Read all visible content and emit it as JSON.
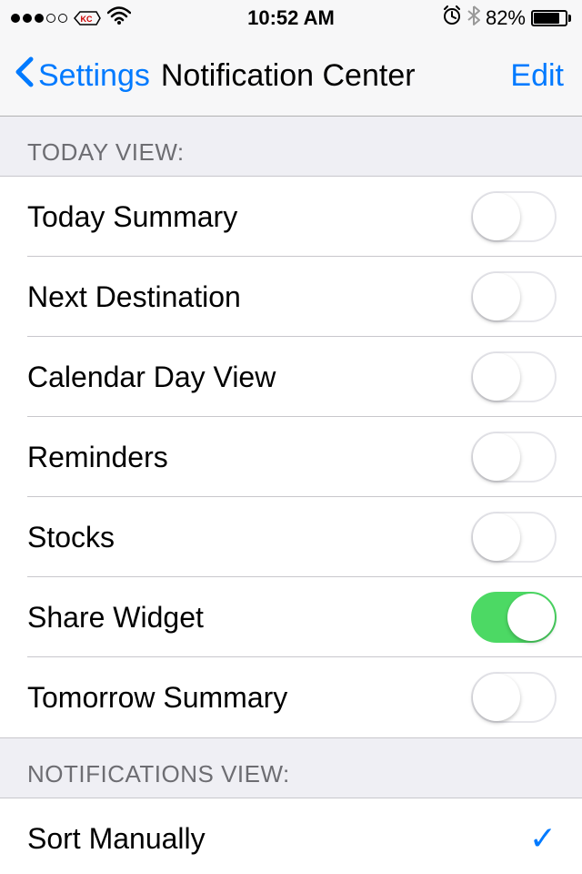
{
  "status": {
    "time": "10:52 AM",
    "battery_pct": "82%"
  },
  "nav": {
    "back_label": "Settings",
    "title": "Notification Center",
    "edit_label": "Edit"
  },
  "sections": {
    "today_view": {
      "header": "TODAY VIEW:",
      "items": [
        {
          "label": "Today Summary",
          "on": false
        },
        {
          "label": "Next Destination",
          "on": false
        },
        {
          "label": "Calendar Day View",
          "on": false
        },
        {
          "label": "Reminders",
          "on": false
        },
        {
          "label": "Stocks",
          "on": false
        },
        {
          "label": "Share Widget",
          "on": true
        },
        {
          "label": "Tomorrow Summary",
          "on": false
        }
      ]
    },
    "notifications_view": {
      "header": "NOTIFICATIONS VIEW:",
      "items": [
        {
          "label": "Sort Manually",
          "checked": true
        }
      ]
    }
  }
}
